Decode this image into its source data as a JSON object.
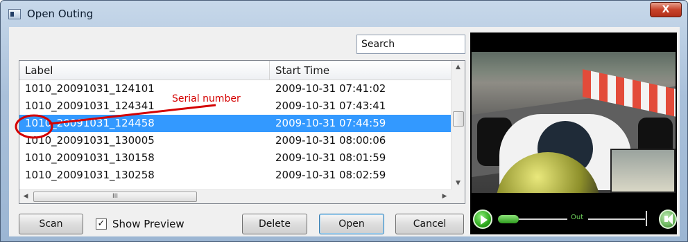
{
  "window": {
    "title": "Open Outing",
    "close_glyph": "X"
  },
  "search": {
    "value": "Search"
  },
  "table": {
    "columns": [
      "Label",
      "Start Time"
    ],
    "rows": [
      {
        "label": "1010_20091031_124101",
        "start": "2009-10-31 07:41:02"
      },
      {
        "label": "1010_20091031_124341",
        "start": "2009-10-31 07:43:41"
      },
      {
        "label": "1010_20091031_124458",
        "start": "2009-10-31 07:44:59",
        "selected": true
      },
      {
        "label": "1010_20091031_130005",
        "start": "2009-10-31 08:00:06"
      },
      {
        "label": "1010_20091031_130158",
        "start": "2009-10-31 08:01:59"
      },
      {
        "label": "1010_20091031_130258",
        "start": "2009-10-31 08:02:59"
      }
    ],
    "hscroll_thumb_glyph": "III"
  },
  "annotation": {
    "text": "Serial number",
    "color": "#d40000"
  },
  "buttons": {
    "scan": "Scan",
    "delete": "Delete",
    "open": "Open",
    "cancel": "Cancel"
  },
  "show_preview": {
    "label": "Show Preview",
    "checked": true
  },
  "preview": {
    "out_label": "Out",
    "play_icon": "play-icon",
    "volume_icon": "speaker-icon"
  },
  "colors": {
    "selection": "#3399ff",
    "accent_green": "#2ea81d"
  }
}
